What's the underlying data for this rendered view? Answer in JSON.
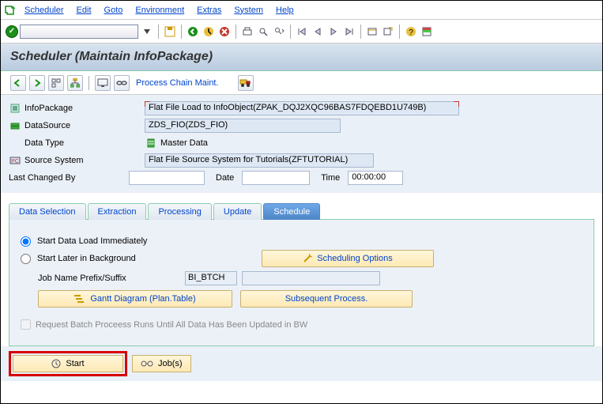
{
  "menu": {
    "items": [
      "Scheduler",
      "Edit",
      "Goto",
      "Environment",
      "Extras",
      "System",
      "Help"
    ]
  },
  "title": "Scheduler (Maintain InfoPackage)",
  "toolbar2": {
    "process_chain": "Process Chain Maint."
  },
  "form": {
    "infopackage_label": "InfoPackage",
    "infopackage_value": "Flat File Load to InfoObject(ZPAK_DQJ2XQC96BAS7FDQEBD1U749B)",
    "datasource_label": "DataSource",
    "datasource_value": "ZDS_FIO(ZDS_FIO)",
    "datatype_label": "Data Type",
    "datatype_value": "Master Data",
    "source_label": "Source System",
    "source_value": "Flat File Source System for Tutorials(ZFTUTORIAL)",
    "lastchanged_label": "Last Changed By",
    "lastchanged_value": "",
    "date_label": "Date",
    "date_value": "",
    "time_label": "Time",
    "time_value": "00:00:00"
  },
  "tabs": [
    "Data Selection",
    "Extraction",
    "Processing",
    "Update",
    "Schedule"
  ],
  "schedule": {
    "radio_now": "Start Data Load Immediately",
    "radio_later": "Start Later in Background",
    "sched_opts": "Scheduling Options",
    "job_label": "Job Name Prefix/Suffix",
    "job_prefix": "BI_BTCH",
    "job_suffix": "",
    "gantt": "Gantt Diagram (Plan.Table)",
    "subseq": "Subsequent Process.",
    "checkbox_text": "Request Batch Proceess Runs Until All Data Has Been Updated in BW"
  },
  "buttons": {
    "start": "Start",
    "jobs": "Job(s)"
  }
}
